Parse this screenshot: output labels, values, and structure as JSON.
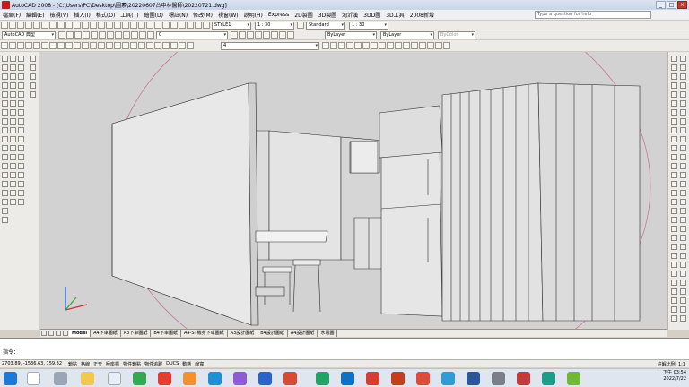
{
  "window": {
    "title": "AutoCAD 2008 - [C:\\Users\\PC\\Desktop\\圖素\\20220607台中林醫師\\20220721.dwg]",
    "min": "_",
    "max": "□",
    "close": "×"
  },
  "menu": {
    "items": [
      "檔案(F)",
      "編輯(E)",
      "檢視(V)",
      "插入(I)",
      "格式(O)",
      "工具(T)",
      "繪圖(D)",
      "標註(N)",
      "修改(M)",
      "視窗(W)",
      "說明(H)",
      "Express",
      "2D製圖",
      "3D製圖",
      "淘沂漢",
      "3DD圖",
      "3D工具",
      "2008新增"
    ],
    "help_placeholder": "Type a question for help"
  },
  "toolbar": {
    "text_style": "STYLE1",
    "scale1": "1 : 30",
    "dim_style": "Standard",
    "scale2": "1 : 30",
    "workspace": "AutoCAD 典型",
    "layer": "0",
    "color": "ByLayer",
    "linetype": "ByLayer",
    "lineweight": "ByColor",
    "elev": "4"
  },
  "tabs": [
    "Model",
    "A4下車圖紙",
    "A3下車圖紙",
    "B4下車圖紙",
    "A4-ST機身下車圖紙",
    "A3設計圖紙",
    "B4設計圖紙",
    "A4設計圖紙",
    "水電圖"
  ],
  "command": {
    "prompt": "指令："
  },
  "status": {
    "coords": "2703.89, -1536.63, 159.32",
    "items": [
      "鎖點",
      "格線",
      "正交",
      "極座標",
      "物件鎖點",
      "物件追蹤",
      "DUCS",
      "動態",
      "線寬"
    ],
    "right": "註解比例: 1:1"
  },
  "taskbar": {
    "time": "下午 03:54",
    "date": "2022/7/22"
  },
  "colors": {
    "title_bg": "#c8d5e8",
    "viewport_bg": "#d2d2d2",
    "taskbar_bg": "#dfe6f0"
  },
  "icons": {
    "app": "autocad-logo-icon",
    "ucs": "ucs-axis-icon"
  }
}
